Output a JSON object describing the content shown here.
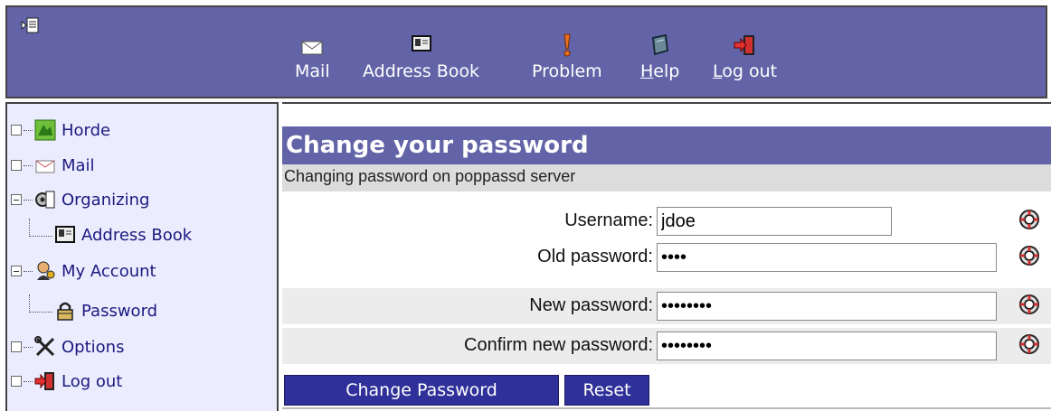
{
  "toolbar": {
    "items": [
      {
        "label": "Mail",
        "icon": "mail-icon"
      },
      {
        "label": "Address Book",
        "icon": "address-book-icon"
      },
      {
        "label": "Problem",
        "icon": "problem-icon"
      },
      {
        "label": "Help",
        "icon": "help-icon"
      },
      {
        "label": "Log out",
        "icon": "logout-icon"
      }
    ]
  },
  "sidebar": {
    "items": [
      {
        "label": "Horde",
        "icon": "horde-icon"
      },
      {
        "label": "Mail",
        "icon": "mail-icon"
      },
      {
        "label": "Organizing",
        "icon": "organizing-icon"
      },
      {
        "label": "Address Book",
        "icon": "address-book-icon"
      },
      {
        "label": "My Account",
        "icon": "my-account-icon"
      },
      {
        "label": "Password",
        "icon": "lock-icon"
      },
      {
        "label": "Options",
        "icon": "options-icon"
      },
      {
        "label": "Log out",
        "icon": "logout-icon"
      }
    ]
  },
  "form": {
    "title": "Change your password",
    "subtitle": "Changing password on poppassd server",
    "fields": [
      {
        "label": "Username:",
        "value": "jdoe"
      },
      {
        "label": "Old password:",
        "value": "••••"
      },
      {
        "label": "New password:",
        "value": "••••••••"
      },
      {
        "label": "Confirm new password:",
        "value": "••••••••"
      }
    ],
    "submit_label": "Change Password",
    "reset_label": "Reset"
  },
  "colors": {
    "header_bg": "#6264a7",
    "sidebar_bg": "#ececff",
    "button_bg": "#2f309a"
  }
}
